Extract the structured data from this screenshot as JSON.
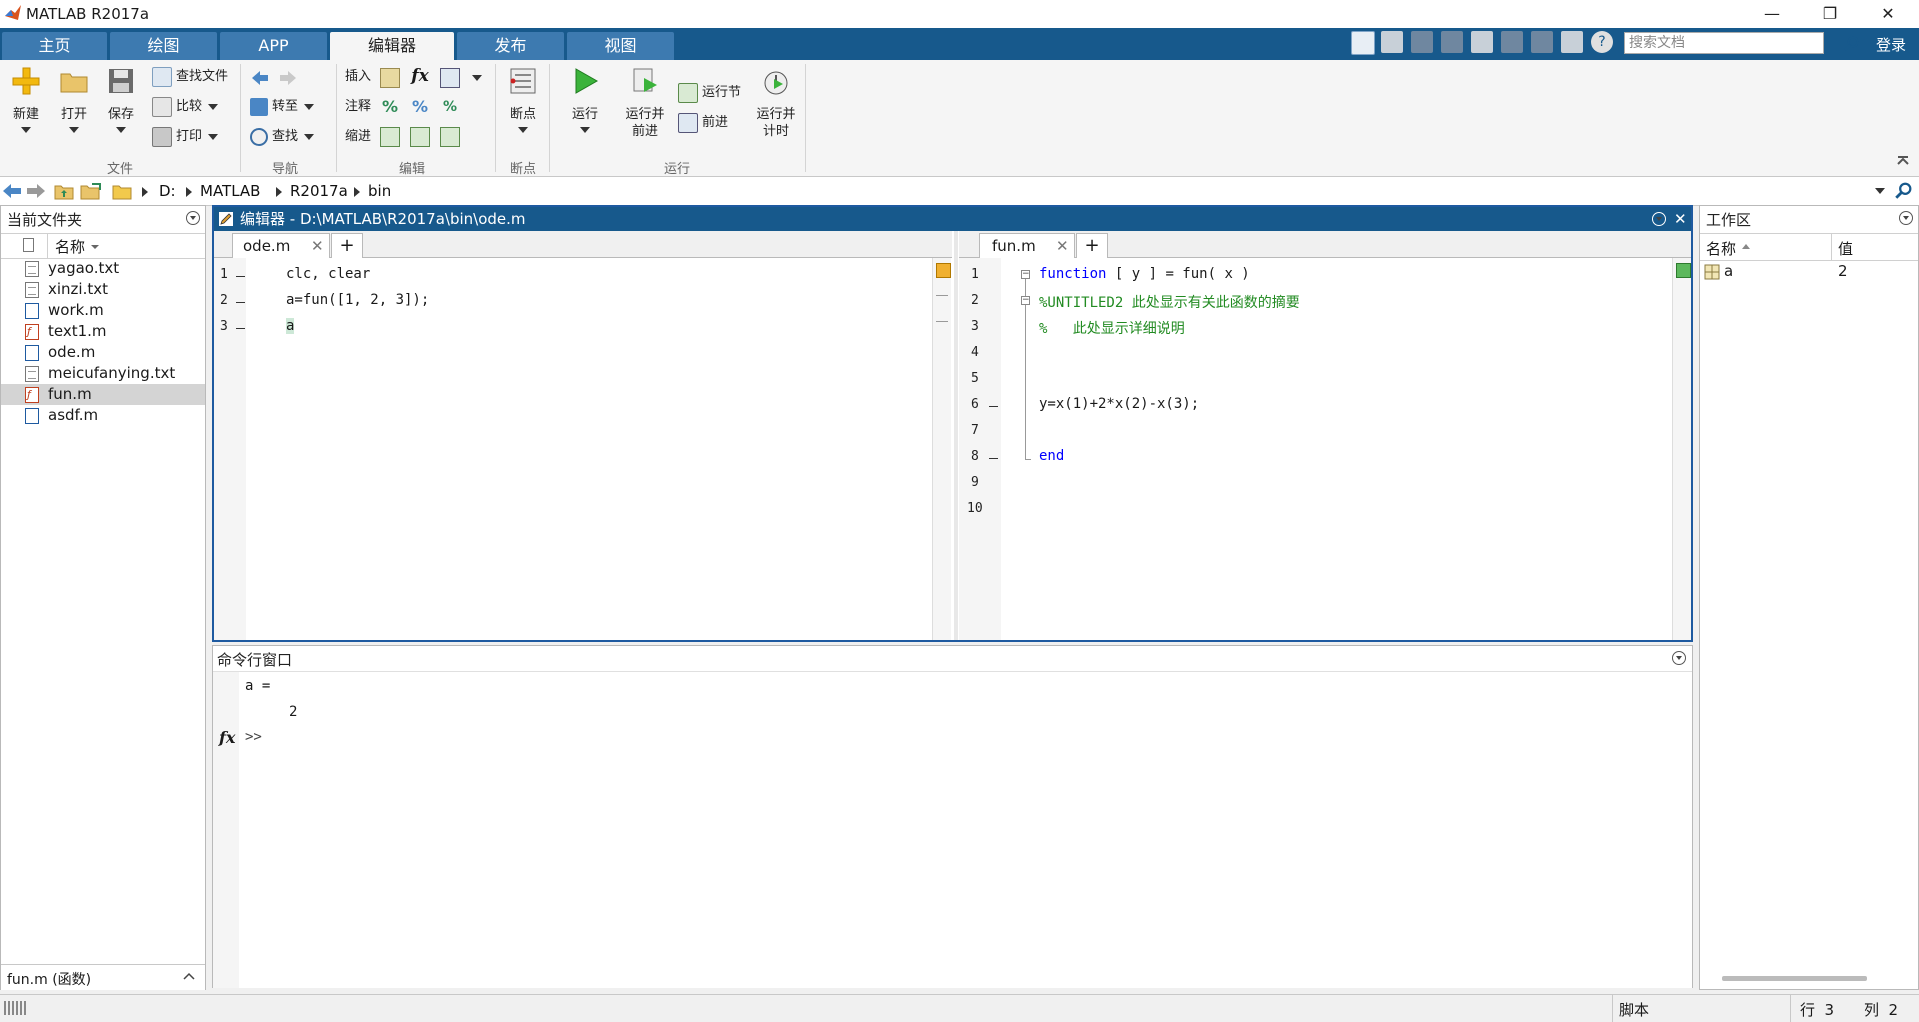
{
  "window": {
    "title": "MATLAB R2017a",
    "minimize": "—",
    "restore": "❐",
    "close": "✕"
  },
  "tabs": [
    {
      "label": "主页"
    },
    {
      "label": "绘图"
    },
    {
      "label": "APP"
    },
    {
      "label": "编辑器"
    },
    {
      "label": "发布"
    },
    {
      "label": "视图"
    }
  ],
  "active_tab": "编辑器",
  "search": {
    "placeholder": "搜索文档"
  },
  "login_label": "登录",
  "ribbon": {
    "file": {
      "new": "新建",
      "open": "打开",
      "save": "保存",
      "find_files": "查找文件",
      "compare": "比较",
      "print": "打印",
      "group": "文件"
    },
    "navigate": {
      "goto": "转至",
      "find": "查找",
      "group": "导航"
    },
    "edit": {
      "insert": "插入",
      "comment": "注释",
      "indent": "缩进",
      "group": "编辑",
      "fx": "fx"
    },
    "breakpoints": {
      "label": "断点",
      "group": "断点"
    },
    "run": {
      "run": "运行",
      "run_advance": "运行并\n前进",
      "run_section": "运行节",
      "advance": "前进",
      "run_time": "运行并\n计时",
      "group": "运行"
    }
  },
  "address": {
    "parts": [
      "D:",
      "MATLAB",
      "R2017a",
      "bin"
    ]
  },
  "current_folder": {
    "title": "当前文件夹",
    "column_name": "名称",
    "files": [
      {
        "name": "yagao.txt",
        "type": "txt"
      },
      {
        "name": "xinzi.txt",
        "type": "txt"
      },
      {
        "name": "work.m",
        "type": "m"
      },
      {
        "name": "text1.m",
        "type": "fx"
      },
      {
        "name": "ode.m",
        "type": "m"
      },
      {
        "name": "meicufanying.txt",
        "type": "txt"
      },
      {
        "name": "fun.m",
        "type": "fx",
        "selected": true
      },
      {
        "name": "asdf.m",
        "type": "m"
      }
    ],
    "detail": "fun.m  (函数)"
  },
  "editor": {
    "title": "编辑器 - D:\\MATLAB\\R2017a\\bin\\ode.m",
    "left": {
      "tab": "ode.m",
      "lines": [
        {
          "n": "1",
          "code": "clc, clear"
        },
        {
          "n": "2",
          "code": "a=fun([1, 2, 3]);"
        },
        {
          "n": "3",
          "code": "a"
        }
      ]
    },
    "right": {
      "tab": "fun.m",
      "line_numbers": [
        "1",
        "2",
        "3",
        "4",
        "5",
        "6",
        "7",
        "8",
        "9",
        "10"
      ],
      "l1_kw": "function",
      "l1_rest": " [ y ] = fun( x )",
      "l2": "%UNTITLED2 此处显示有关此函数的摘要",
      "l3": "%   此处显示详细说明",
      "l6": "y=x(1)+2*x(2)-x(3);",
      "l8": "end"
    }
  },
  "command_window": {
    "title": "命令行窗口",
    "output_1": "a =",
    "output_2": "2",
    "prompt": ">>",
    "fx": "fx"
  },
  "workspace": {
    "title": "工作区",
    "col_name": "名称",
    "col_value": "值",
    "vars": [
      {
        "name": "a",
        "value": "2"
      }
    ]
  },
  "status": {
    "mode": "脚本",
    "row": "行  3",
    "col": "列  2"
  },
  "colors": {
    "accent": "#17598c",
    "keyword": "#0000ff",
    "comment": "#228b22"
  }
}
